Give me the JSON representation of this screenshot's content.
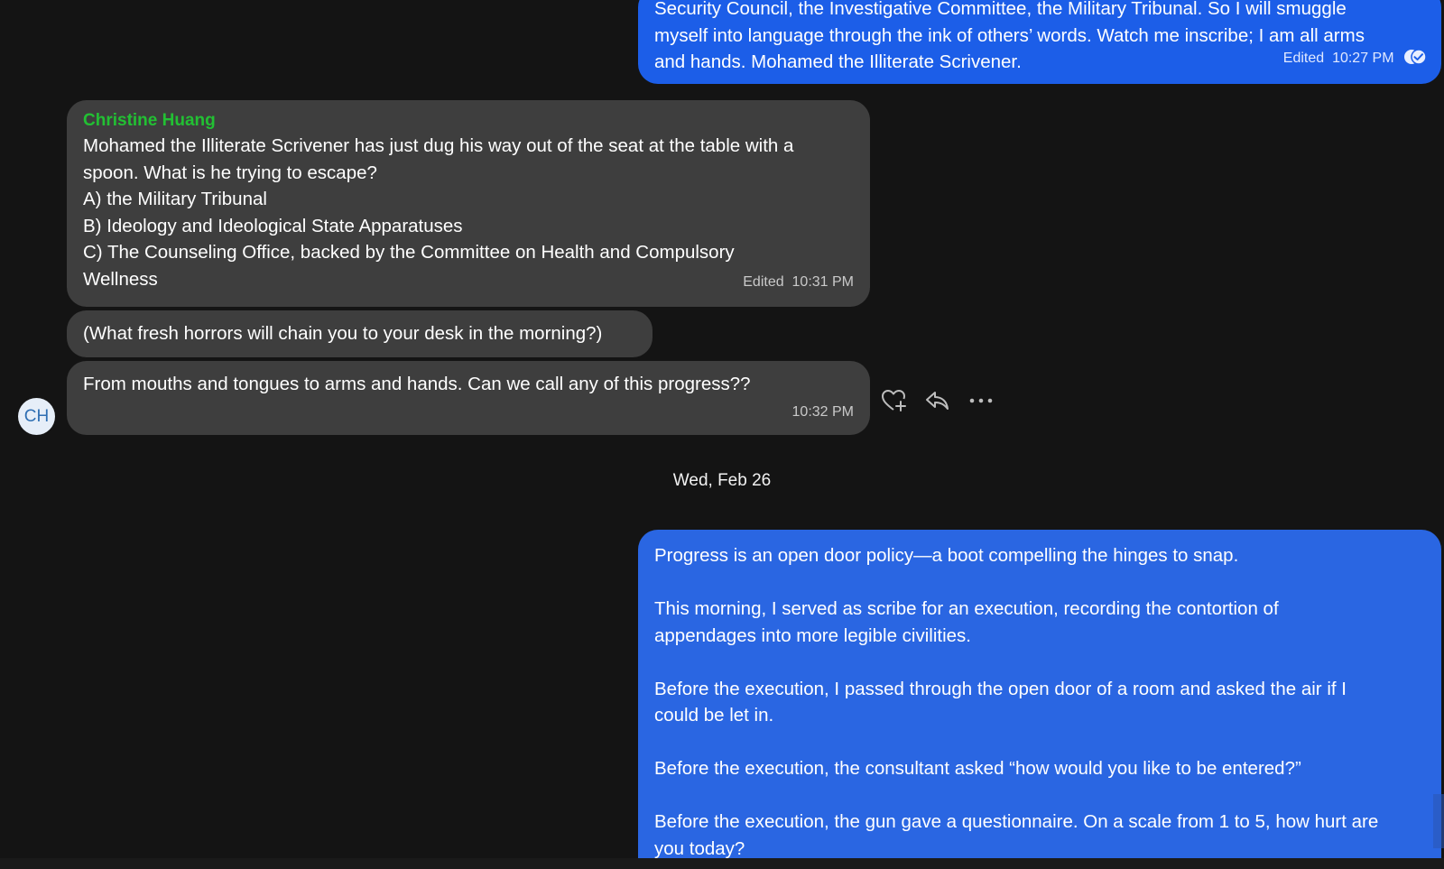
{
  "colors": {
    "background": "#141414",
    "outgoing_bubble": "#1c5ee8",
    "incoming_bubble": "#3e3e3e",
    "sender_name": "#22c033",
    "avatar_bg": "#e6eef8",
    "avatar_text": "#2f6fb3"
  },
  "messages": {
    "top_out": {
      "lines": [
        "Security Council, the Investigative Committee, the Military Tribunal. So I will smuggle",
        "myself into language through the ink of others’ words. Watch me inscribe; I am all arms",
        "and hands. Mohamed the Illiterate Scrivener."
      ],
      "edited": "Edited",
      "time": "10:27 PM",
      "status_icon": "double-check-icon"
    },
    "in1": {
      "sender": "Christine Huang",
      "lines": [
        "Mohamed the Illiterate Scrivener has just dug his way out of the seat at the table with a",
        "spoon. What is he trying to escape?",
        "A) the Military Tribunal",
        "B) Ideology and Ideological State Apparatuses",
        "C) The Counseling Office, backed by the Committee on Health and Compulsory",
        "Wellness"
      ],
      "edited": "Edited",
      "time": "10:31 PM"
    },
    "in2": {
      "text": "(What fresh horrors will chain you to your desk in the morning?)"
    },
    "in3": {
      "text": "From mouths and tongues to arms and hands. Can we call any of this progress??",
      "time": "10:32 PM"
    },
    "bottom_out": {
      "p1": "Progress is an open door policy—a boot compelling the hinges to snap.",
      "p2": [
        "This morning, I served as scribe for an execution, recording the contortion of",
        "appendages into more legible civilities."
      ],
      "p3": [
        "Before the execution, I passed through the open door of a room and asked the air if I",
        "could be let in."
      ],
      "p4": "Before the execution, the consultant asked “how would you like to be entered?”",
      "p5": [
        "Before the execution, the gun gave a questionnaire. On a scale from 1 to 5, how hurt are",
        "you today?"
      ]
    }
  },
  "avatar": {
    "initials": "CH"
  },
  "actions": {
    "react_icon": "heart-plus-icon",
    "reply_icon": "reply-icon",
    "more_icon": "more-options-icon"
  },
  "date_separator": "Wed, Feb 26"
}
